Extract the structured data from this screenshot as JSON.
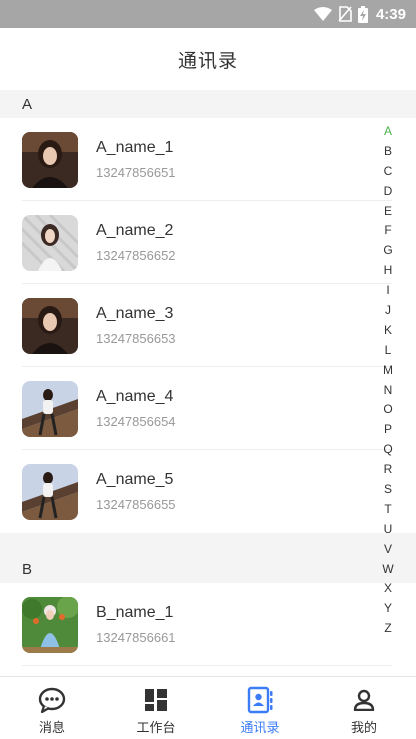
{
  "status_bar": {
    "time": "4:39"
  },
  "header": {
    "title": "通讯录"
  },
  "sections": [
    {
      "letter": "A",
      "contacts": [
        {
          "name": "A_name_1",
          "phone": "13247856651"
        },
        {
          "name": "A_name_2",
          "phone": "13247856652"
        },
        {
          "name": "A_name_3",
          "phone": "13247856653"
        },
        {
          "name": "A_name_4",
          "phone": "13247856654"
        },
        {
          "name": "A_name_5",
          "phone": "13247856655"
        }
      ]
    },
    {
      "letter": "B",
      "contacts": [
        {
          "name": "B_name_1",
          "phone": "13247856661"
        }
      ]
    }
  ],
  "index_letters": [
    "A",
    "B",
    "C",
    "D",
    "E",
    "F",
    "G",
    "H",
    "I",
    "J",
    "K",
    "L",
    "M",
    "N",
    "O",
    "P",
    "Q",
    "R",
    "S",
    "T",
    "U",
    "V",
    "W",
    "X",
    "Y",
    "Z"
  ],
  "active_index_letter": "A",
  "tabs": [
    {
      "label": "消息",
      "icon": "chat-bubble-icon"
    },
    {
      "label": "工作台",
      "icon": "grid-icon"
    },
    {
      "label": "通讯录",
      "icon": "contacts-book-icon"
    },
    {
      "label": "我的",
      "icon": "user-icon"
    }
  ],
  "active_tab": "通讯录",
  "colors": {
    "accent_blue": "#3d7cf7",
    "index_active_green": "#4caf50",
    "status_bar": "#a6a6a6",
    "section_header_bg": "#f4f4f4"
  }
}
